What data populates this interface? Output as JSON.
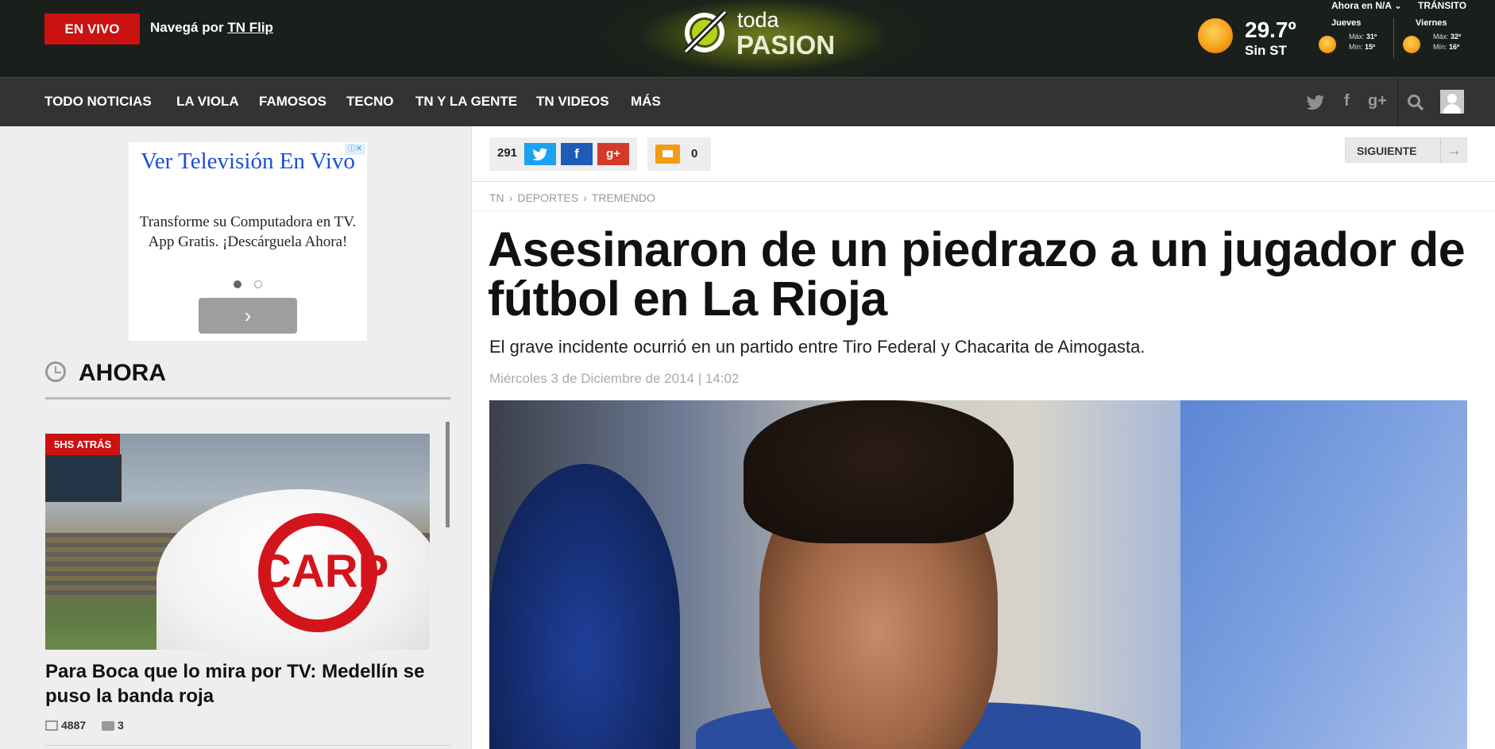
{
  "header": {
    "live_label": "EN VIVO",
    "flip_prefix": "Navegá por",
    "flip_link": "TN Flip",
    "logo_top": "toda",
    "logo_bottom": "PASION",
    "weather": {
      "ahora_label": "Ahora en N/A",
      "transito_label": "TRÁNSITO",
      "temp": "29.7º",
      "st": "Sin ST",
      "forecast": [
        {
          "day": "Jueves",
          "max_label": "Máx:",
          "max": "31º",
          "min_label": "Mín:",
          "min": "15º"
        },
        {
          "day": "Viernes",
          "max_label": "Máx:",
          "max": "32º",
          "min_label": "Mín:",
          "min": "16º"
        }
      ]
    }
  },
  "nav": {
    "items": [
      "TODO NOTICIAS",
      "LA VIOLA",
      "FAMOSOS",
      "TECNO",
      "TN Y LA GENTE",
      "TN VIDEOS",
      "MÁS"
    ],
    "icons": [
      "twitter-icon",
      "facebook-icon",
      "google-plus-icon",
      "search-icon",
      "user-avatar-icon"
    ]
  },
  "ad": {
    "title": "Ver Televisión En Vivo",
    "body": "Transforme su Computadora en TV. App Gratis. ¡Descárguela Ahora!",
    "cta_glyph": "›",
    "choices_glyph": "ⓘ✕"
  },
  "sidebar": {
    "section_title": "AHORA",
    "news": {
      "badge": "5HS ATRÁS",
      "crest_text": "CARP",
      "title": "Para Boca que lo mira por TV: Medellín se puso la banda roja",
      "shares": "4887",
      "comments": "3"
    }
  },
  "article": {
    "share_count": "291",
    "share_buttons": [
      "twitter",
      "facebook",
      "google-plus"
    ],
    "comments_count": "0",
    "next_label": "SIGUIENTE",
    "next_arrow": "→",
    "breadcrumb": [
      "TN",
      "DEPORTES",
      "TREMENDO"
    ],
    "headline": "Asesinaron de un piedrazo a un jugador de fútbol en La Rioja",
    "subhead": "El grave incidente ocurrió en un partido entre Tiro Federal y Chacarita de Aimogasta.",
    "date": "Miércoles 3 de Diciembre de 2014",
    "time": "14:02"
  },
  "colors": {
    "live_red": "#cc1111",
    "twitter": "#1da1f2",
    "facebook": "#1d5bb7",
    "google_plus": "#d23a2b",
    "comment_orange": "#f39c12"
  }
}
